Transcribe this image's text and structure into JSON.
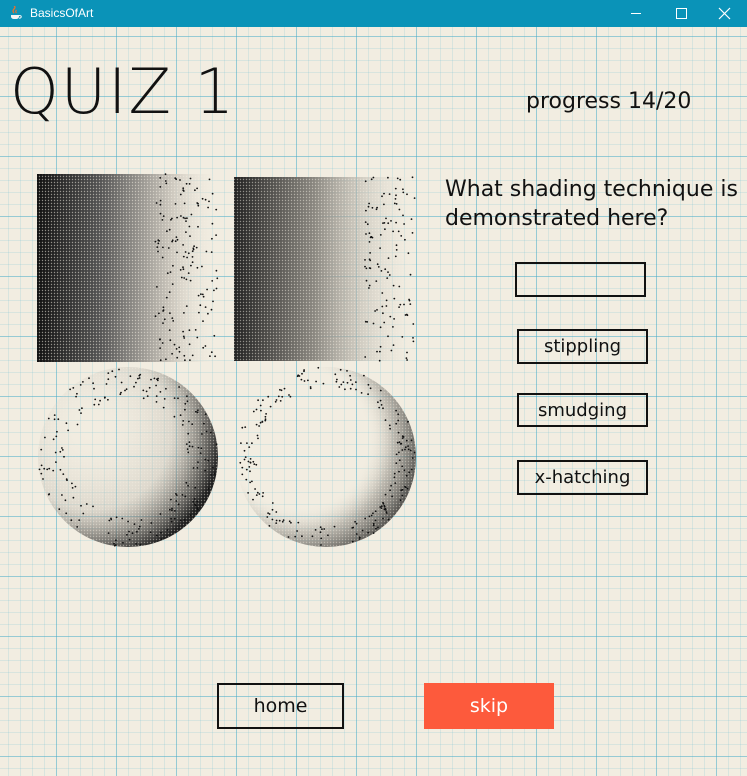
{
  "window": {
    "title": "BasicsOfArt",
    "controls": [
      "minimize-icon",
      "maximize-icon",
      "close-icon"
    ]
  },
  "quiz": {
    "title": "QUIZ 1",
    "progress": "progress 14/20",
    "question": "What shading technique is demonstrated here?"
  },
  "answers": [
    {
      "label": ""
    },
    {
      "label": "stippling"
    },
    {
      "label": "smudging"
    },
    {
      "label": "x-hatching"
    }
  ],
  "footer": {
    "home_label": "home",
    "skip_label": "skip"
  },
  "colors": {
    "titlebar": "#0a93b8",
    "skip": "#fd5a3c",
    "paper": "#f2ede1",
    "grid": "#46aac8"
  }
}
